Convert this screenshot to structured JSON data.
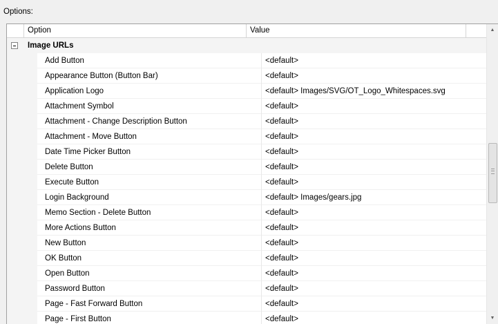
{
  "options_label": "Options:",
  "grid": {
    "columns": {
      "option": "Option",
      "value": "Value"
    },
    "category": {
      "label": "Image URLs",
      "expander_icon": "minus-box-icon"
    },
    "rows": [
      {
        "name": "Add Button",
        "value": "<default>"
      },
      {
        "name": "Appearance Button (Button Bar)",
        "value": "<default>"
      },
      {
        "name": "Application Logo",
        "value": "<default> Images/SVG/OT_Logo_Whitespaces.svg"
      },
      {
        "name": "Attachment Symbol",
        "value": "<default>"
      },
      {
        "name": "Attachment - Change Description Button",
        "value": "<default>"
      },
      {
        "name": "Attachment - Move Button",
        "value": "<default>"
      },
      {
        "name": "Date Time Picker Button",
        "value": "<default>"
      },
      {
        "name": "Delete Button",
        "value": "<default>"
      },
      {
        "name": "Execute Button",
        "value": "<default>"
      },
      {
        "name": "Login Background",
        "value": "<default> Images/gears.jpg"
      },
      {
        "name": "Memo Section - Delete Button",
        "value": "<default>"
      },
      {
        "name": "More Actions Button",
        "value": "<default>"
      },
      {
        "name": "New Button",
        "value": "<default>"
      },
      {
        "name": "OK Button",
        "value": "<default>"
      },
      {
        "name": "Open Button",
        "value": "<default>"
      },
      {
        "name": "Password Button",
        "value": "<default>"
      },
      {
        "name": "Page - Fast Forward Button",
        "value": "<default>"
      },
      {
        "name": "Page - First Button",
        "value": "<default>"
      }
    ]
  },
  "scrollbar": {
    "up_icon": "▲",
    "down_icon": "▼",
    "grip_icon": "grip-lines-icon"
  }
}
